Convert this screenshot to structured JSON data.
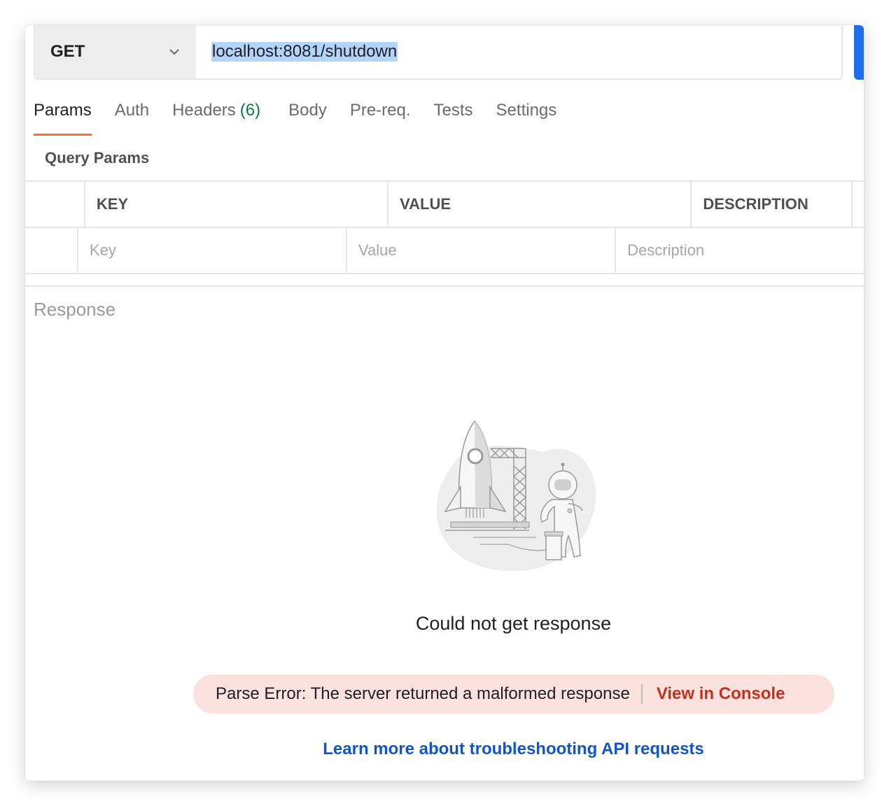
{
  "request": {
    "method": "GET",
    "url": "localhost:8081/shutdown"
  },
  "tabs": [
    {
      "label": "Params",
      "active": true
    },
    {
      "label": "Auth"
    },
    {
      "label": "Headers",
      "count": "(6)"
    },
    {
      "label": "Body"
    },
    {
      "label": "Pre-req."
    },
    {
      "label": "Tests"
    },
    {
      "label": "Settings"
    }
  ],
  "params": {
    "title": "Query Params",
    "headers": [
      "KEY",
      "VALUE",
      "DESCRIPTION"
    ],
    "placeholders": {
      "key": "Key",
      "value": "Value",
      "description": "Description"
    }
  },
  "response": {
    "title": "Response",
    "message": "Could not get response",
    "error_text": "Parse Error: The server returned a malformed response",
    "error_link": "View in Console",
    "learn_more": "Learn more about troubleshooting API requests"
  },
  "colors": {
    "accent": "#ff6c37",
    "send_button": "#1f6feb",
    "error_bg": "#fbe2df",
    "error_link": "#c4311b",
    "link": "#1155cc",
    "count_green": "#0f7b3f"
  },
  "icons": {
    "method_dropdown": "chevron-down-icon",
    "illustration": "rocket-astronaut-illustration"
  }
}
